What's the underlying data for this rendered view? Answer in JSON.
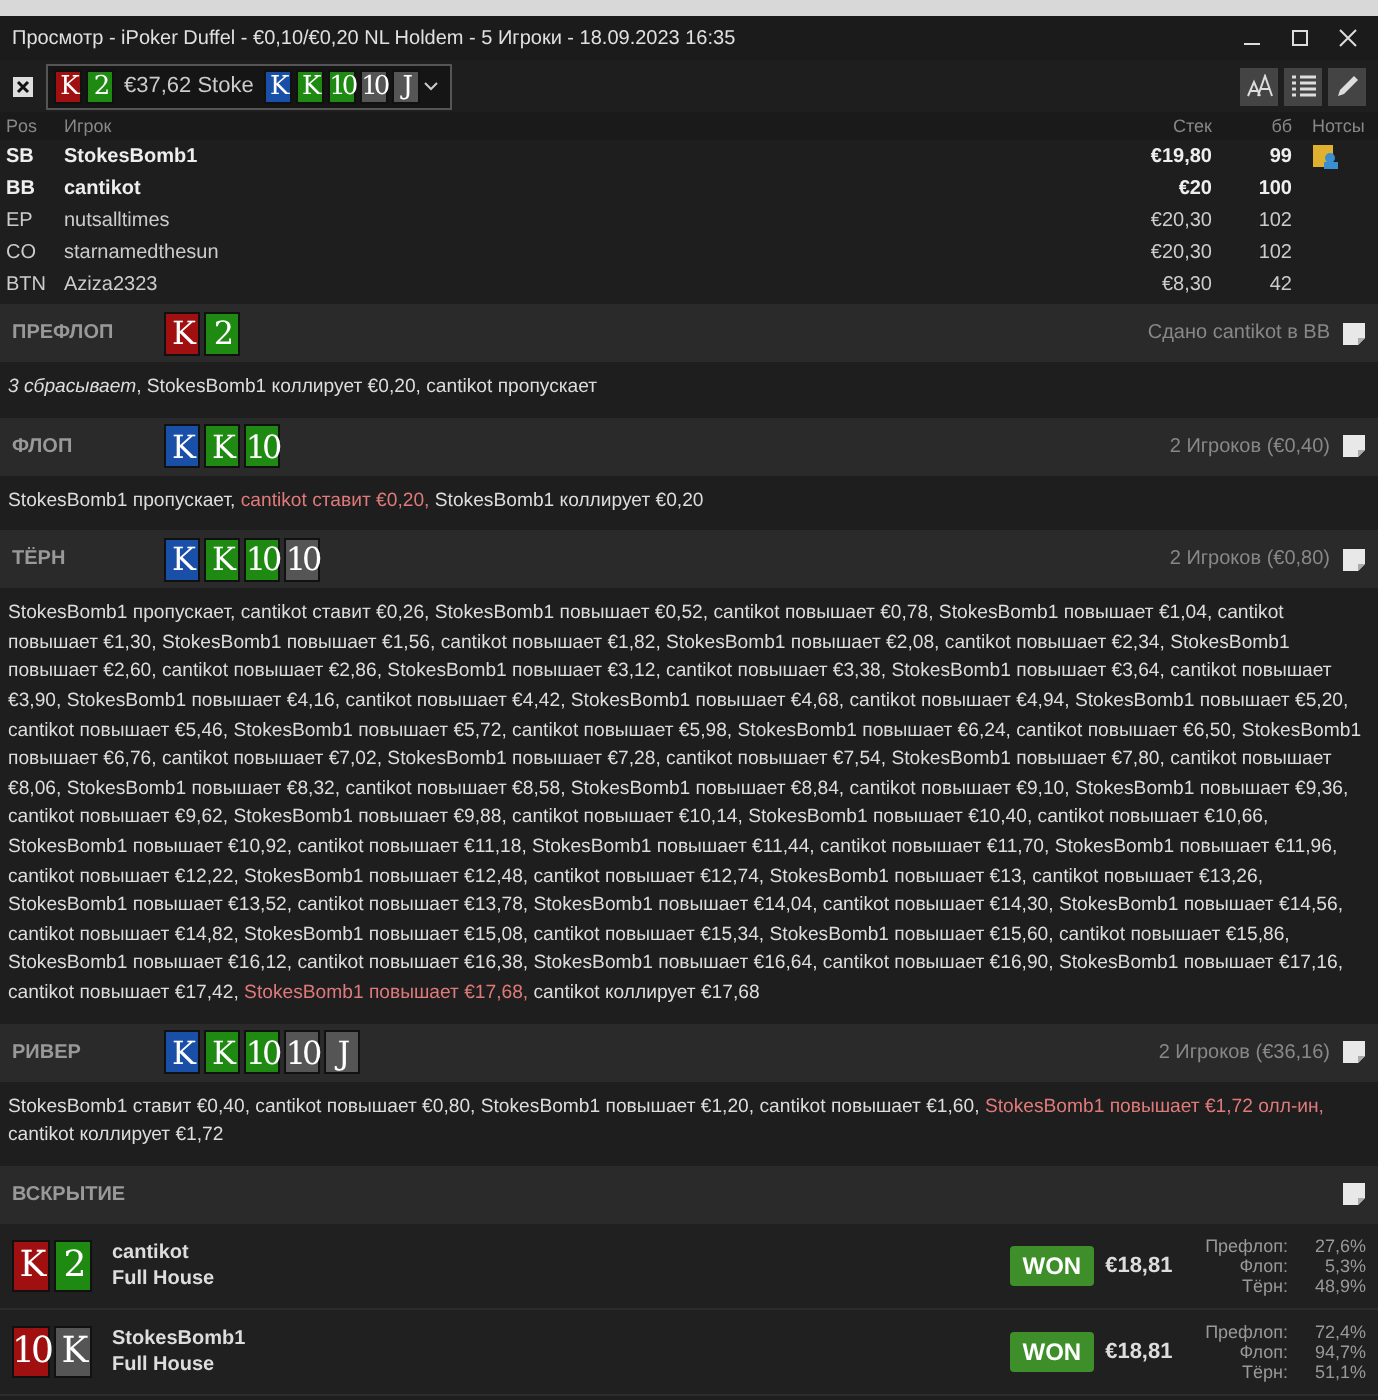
{
  "window": {
    "title": "Просмотр - iPoker Duffel - €0,10/€0,20 NL Holdem - 5 Игроки - 18.09.2023 16:35"
  },
  "hand_selector": {
    "hero_cards": [
      {
        "rank": "K",
        "color": "#a01010"
      },
      {
        "rank": "2",
        "color": "#1e8a12"
      }
    ],
    "value": "€37,62 Stoke",
    "board": [
      {
        "rank": "K",
        "color": "#1a4fa8"
      },
      {
        "rank": "K",
        "color": "#1e8a12"
      },
      {
        "rank": "10",
        "color": "#1e8a12"
      },
      {
        "rank": "10",
        "color": "#555555"
      },
      {
        "rank": "J",
        "color": "#555555"
      }
    ]
  },
  "players": {
    "columns": [
      "Pos",
      "Игрок",
      "Стек",
      "бб",
      "Нотсы"
    ],
    "rows": [
      {
        "pos": "SB",
        "name": "StokesBomb1",
        "stack": "€19,80",
        "bb": "99",
        "bold": true,
        "note": true
      },
      {
        "pos": "BB",
        "name": "cantikot",
        "stack": "€20",
        "bb": "100",
        "bold": true,
        "note": false
      },
      {
        "pos": "EP",
        "name": "nutsalltimes",
        "stack": "€20,30",
        "bb": "102",
        "bold": false,
        "note": false
      },
      {
        "pos": "CO",
        "name": "starnamedthesun",
        "stack": "€20,30",
        "bb": "102",
        "bold": false,
        "note": false
      },
      {
        "pos": "BTN",
        "name": "Aziza2323",
        "stack": "€8,30",
        "bb": "42",
        "bold": false,
        "note": false
      }
    ]
  },
  "streets": [
    {
      "name": "ПРЕФЛОП",
      "cards": [
        {
          "rank": "K",
          "color": "#a01010"
        },
        {
          "rank": "2",
          "color": "#1e8a12"
        }
      ],
      "info": "Сдано cantikot в BB",
      "actions": [
        {
          "kind": "fold",
          "text": "3 сбрасывает"
        },
        {
          "kind": "plain",
          "text": ", StokesBomb1 коллирует €0,20, cantikot пропускает"
        }
      ]
    },
    {
      "name": "ФЛОП",
      "cards": [
        {
          "rank": "K",
          "color": "#1a4fa8"
        },
        {
          "rank": "K",
          "color": "#1e8a12"
        },
        {
          "rank": "10",
          "color": "#1e8a12"
        }
      ],
      "info": "2 Игроков (€0,40)",
      "actions": [
        {
          "kind": "plain",
          "text": "StokesBomb1 пропускает, "
        },
        {
          "kind": "aggressive",
          "text": "cantikot ставит €0,20,"
        },
        {
          "kind": "plain",
          "text": " StokesBomb1 коллирует €0,20"
        }
      ]
    },
    {
      "name": "ТЁРН",
      "cards": [
        {
          "rank": "K",
          "color": "#1a4fa8"
        },
        {
          "rank": "K",
          "color": "#1e8a12"
        },
        {
          "rank": "10",
          "color": "#1e8a12"
        },
        {
          "rank": "10",
          "color": "#555555"
        }
      ],
      "info": "2 Игроков (€0,80)",
      "actions": [
        {
          "kind": "plain",
          "text": "StokesBomb1 пропускает, cantikot ставит €0,26, StokesBomb1 повышает €0,52, cantikot повышает €0,78, StokesBomb1 повышает €1,04, cantikot повышает €1,30, StokesBomb1 повышает €1,56, cantikot повышает €1,82, StokesBomb1 повышает €2,08, cantikot повышает €2,34, StokesBomb1 повышает €2,60, cantikot повышает €2,86, StokesBomb1 повышает €3,12, cantikot повышает €3,38, StokesBomb1 повышает €3,64, cantikot повышает €3,90, StokesBomb1 повышает €4,16, cantikot повышает €4,42, StokesBomb1 повышает €4,68, cantikot повышает €4,94, StokesBomb1 повышает €5,20, cantikot повышает €5,46, StokesBomb1 повышает €5,72, cantikot повышает €5,98, StokesBomb1 повышает €6,24, cantikot повышает €6,50, StokesBomb1 повышает €6,76, cantikot повышает €7,02, StokesBomb1 повышает €7,28, cantikot повышает €7,54, StokesBomb1 повышает €7,80, cantikot повышает €8,06, StokesBomb1 повышает €8,32, cantikot повышает €8,58, StokesBomb1 повышает €8,84, cantikot повышает €9,10, StokesBomb1 повышает €9,36, cantikot повышает €9,62, StokesBomb1 повышает €9,88, cantikot повышает €10,14, StokesBomb1 повышает €10,40, cantikot повышает €10,66, StokesBomb1 повышает €10,92, cantikot повышает €11,18, StokesBomb1 повышает €11,44, cantikot повышает €11,70, StokesBomb1 повышает €11,96, cantikot повышает €12,22, StokesBomb1 повышает €12,48, cantikot повышает €12,74, StokesBomb1 повышает €13, cantikot повышает €13,26, StokesBomb1 повышает €13,52, cantikot повышает €13,78, StokesBomb1 повышает €14,04, cantikot повышает €14,30, StokesBomb1 повышает €14,56, cantikot повышает €14,82, StokesBomb1 повышает €15,08, cantikot повышает €15,34, StokesBomb1 повышает €15,60, cantikot повышает €15,86, StokesBomb1 повышает €16,12, cantikot повышает €16,38, StokesBomb1 повышает €16,64, cantikot повышает €16,90, StokesBomb1 повышает €17,16, cantikot повышает €17,42, "
        },
        {
          "kind": "aggressive",
          "text": "StokesBomb1 повышает €17,68,"
        },
        {
          "kind": "plain",
          "text": " cantikot коллирует €17,68"
        }
      ]
    },
    {
      "name": "РИВЕР",
      "cards": [
        {
          "rank": "K",
          "color": "#1a4fa8"
        },
        {
          "rank": "K",
          "color": "#1e8a12"
        },
        {
          "rank": "10",
          "color": "#1e8a12"
        },
        {
          "rank": "10",
          "color": "#555555"
        },
        {
          "rank": "J",
          "color": "#555555"
        }
      ],
      "info": "2 Игроков (€36,16)",
      "actions": [
        {
          "kind": "plain",
          "text": "StokesBomb1 ставит €0,40, cantikot повышает €0,80, StokesBomb1 повышает €1,20, cantikot повышает €1,60, "
        },
        {
          "kind": "aggressive",
          "text": "StokesBomb1 повышает €1,72 олл-ин,"
        },
        {
          "kind": "plain",
          "text": " cantikot коллирует €1,72"
        }
      ]
    }
  ],
  "showdown": {
    "title": "ВСКРЫТИЕ",
    "hands": [
      {
        "cards": [
          {
            "rank": "K",
            "color": "#a01010"
          },
          {
            "rank": "2",
            "color": "#1e8a12"
          }
        ],
        "name": "cantikot",
        "hand": "Full House",
        "result": "WON",
        "amount": "€18,81",
        "equity": [
          {
            "label": "Префлоп:",
            "value": "27,6%"
          },
          {
            "label": "Флоп:",
            "value": "5,3%"
          },
          {
            "label": "Тёрн:",
            "value": "48,9%"
          }
        ]
      },
      {
        "cards": [
          {
            "rank": "10",
            "color": "#a01010"
          },
          {
            "rank": "K",
            "color": "#555555"
          }
        ],
        "name": "StokesBomb1",
        "hand": "Full House",
        "result": "WON",
        "amount": "€18,81",
        "equity": [
          {
            "label": "Префлоп:",
            "value": "72,4%"
          },
          {
            "label": "Флоп:",
            "value": "94,7%"
          },
          {
            "label": "Тёрн:",
            "value": "51,1%"
          }
        ]
      }
    ]
  }
}
